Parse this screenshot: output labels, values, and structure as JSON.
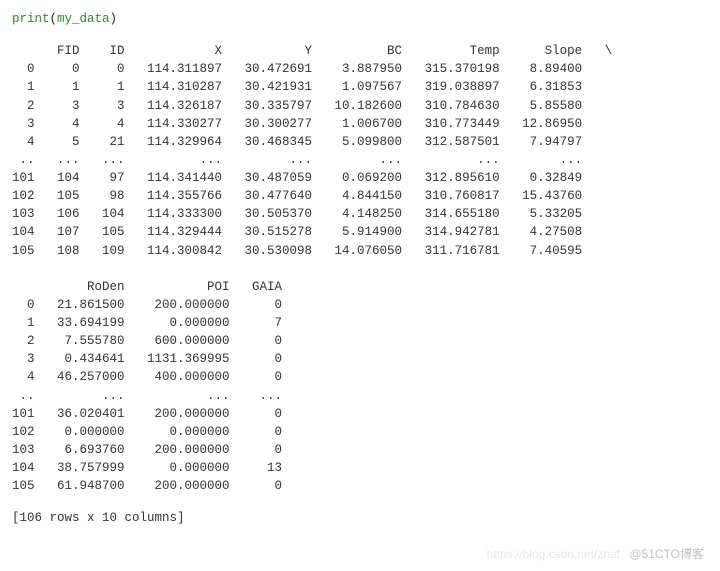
{
  "code": {
    "fn": "print",
    "open": "(",
    "arg": "my_data",
    "close": ")"
  },
  "table1": {
    "columns": [
      "",
      "FID",
      "ID",
      "X",
      "Y",
      "BC",
      "Temp",
      "Slope",
      "\\"
    ],
    "rows_top": [
      [
        "0",
        "0",
        "0",
        "114.311897",
        "30.472691",
        "3.887950",
        "315.370198",
        "8.89400",
        ""
      ],
      [
        "1",
        "1",
        "1",
        "114.310287",
        "30.421931",
        "1.097567",
        "319.038897",
        "6.31853",
        ""
      ],
      [
        "2",
        "3",
        "3",
        "114.326187",
        "30.335797",
        "10.182600",
        "310.784630",
        "5.85580",
        ""
      ],
      [
        "3",
        "4",
        "4",
        "114.330277",
        "30.300277",
        "1.006700",
        "310.773449",
        "12.86950",
        ""
      ],
      [
        "4",
        "5",
        "21",
        "114.329964",
        "30.468345",
        "5.099800",
        "312.587501",
        "7.94797",
        ""
      ]
    ],
    "ellipsis": [
      "..",
      "...",
      "...",
      "...",
      "...",
      "...",
      "...",
      "...",
      ""
    ],
    "rows_bottom": [
      [
        "101",
        "104",
        "97",
        "114.341440",
        "30.487059",
        "0.069200",
        "312.895610",
        "0.32849",
        ""
      ],
      [
        "102",
        "105",
        "98",
        "114.355766",
        "30.477640",
        "4.844150",
        "310.760817",
        "15.43760",
        ""
      ],
      [
        "103",
        "106",
        "104",
        "114.333300",
        "30.505370",
        "4.148250",
        "314.655180",
        "5.33205",
        ""
      ],
      [
        "104",
        "107",
        "105",
        "114.329444",
        "30.515278",
        "5.914900",
        "314.942781",
        "4.27508",
        ""
      ],
      [
        "105",
        "108",
        "109",
        "114.300842",
        "30.530098",
        "14.076050",
        "311.716781",
        "7.40595",
        ""
      ]
    ]
  },
  "table2": {
    "columns": [
      "",
      "RoDen",
      "POI",
      "GAIA"
    ],
    "rows_top": [
      [
        "0",
        "21.861500",
        "200.000000",
        "0"
      ],
      [
        "1",
        "33.694199",
        "0.000000",
        "7"
      ],
      [
        "2",
        "7.555780",
        "600.000000",
        "0"
      ],
      [
        "3",
        "0.434641",
        "1131.369995",
        "0"
      ],
      [
        "4",
        "46.257000",
        "400.000000",
        "0"
      ]
    ],
    "ellipsis": [
      "..",
      "...",
      "...",
      "..."
    ],
    "rows_bottom": [
      [
        "101",
        "36.020401",
        "200.000000",
        "0"
      ],
      [
        "102",
        "0.000000",
        "0.000000",
        "0"
      ],
      [
        "103",
        "6.693760",
        "200.000000",
        "0"
      ],
      [
        "104",
        "38.757999",
        "0.000000",
        "13"
      ],
      [
        "105",
        "61.948700",
        "200.000000",
        "0"
      ]
    ]
  },
  "summary": "[106 rows x 10 columns]",
  "watermark_faint": "https://blog.csdn.net/zhat",
  "watermark": "@51CTO博客",
  "chart_data": {
    "type": "table",
    "title": "pandas DataFrame printout (my_data)",
    "columns": [
      "FID",
      "ID",
      "X",
      "Y",
      "BC",
      "Temp",
      "Slope",
      "RoDen",
      "POI",
      "GAIA"
    ],
    "index_shown": [
      0,
      1,
      2,
      3,
      4,
      101,
      102,
      103,
      104,
      105
    ],
    "total_rows": 106,
    "total_columns": 10,
    "rows": [
      {
        "index": 0,
        "FID": 0,
        "ID": 0,
        "X": 114.311897,
        "Y": 30.472691,
        "BC": 3.88795,
        "Temp": 315.370198,
        "Slope": 8.894,
        "RoDen": 21.8615,
        "POI": 200.0,
        "GAIA": 0
      },
      {
        "index": 1,
        "FID": 1,
        "ID": 1,
        "X": 114.310287,
        "Y": 30.421931,
        "BC": 1.097567,
        "Temp": 319.038897,
        "Slope": 6.31853,
        "RoDen": 33.694199,
        "POI": 0.0,
        "GAIA": 7
      },
      {
        "index": 2,
        "FID": 3,
        "ID": 3,
        "X": 114.326187,
        "Y": 30.335797,
        "BC": 10.1826,
        "Temp": 310.78463,
        "Slope": 5.8558,
        "RoDen": 7.55578,
        "POI": 600.0,
        "GAIA": 0
      },
      {
        "index": 3,
        "FID": 4,
        "ID": 4,
        "X": 114.330277,
        "Y": 30.300277,
        "BC": 1.0067,
        "Temp": 310.773449,
        "Slope": 12.8695,
        "RoDen": 0.434641,
        "POI": 1131.369995,
        "GAIA": 0
      },
      {
        "index": 4,
        "FID": 5,
        "ID": 21,
        "X": 114.329964,
        "Y": 30.468345,
        "BC": 5.0998,
        "Temp": 312.587501,
        "Slope": 7.94797,
        "RoDen": 46.257,
        "POI": 400.0,
        "GAIA": 0
      },
      {
        "index": 101,
        "FID": 104,
        "ID": 97,
        "X": 114.34144,
        "Y": 30.487059,
        "BC": 0.0692,
        "Temp": 312.89561,
        "Slope": 0.32849,
        "RoDen": 36.020401,
        "POI": 200.0,
        "GAIA": 0
      },
      {
        "index": 102,
        "FID": 105,
        "ID": 98,
        "X": 114.355766,
        "Y": 30.47764,
        "BC": 4.84415,
        "Temp": 310.760817,
        "Slope": 15.4376,
        "RoDen": 0.0,
        "POI": 0.0,
        "GAIA": 0
      },
      {
        "index": 103,
        "FID": 106,
        "ID": 104,
        "X": 114.3333,
        "Y": 30.50537,
        "BC": 4.14825,
        "Temp": 314.65518,
        "Slope": 5.33205,
        "RoDen": 6.69376,
        "POI": 200.0,
        "GAIA": 0
      },
      {
        "index": 104,
        "FID": 107,
        "ID": 105,
        "X": 114.329444,
        "Y": 30.515278,
        "BC": 5.9149,
        "Temp": 314.942781,
        "Slope": 4.27508,
        "RoDen": 38.757999,
        "POI": 0.0,
        "GAIA": 13
      },
      {
        "index": 105,
        "FID": 108,
        "ID": 109,
        "X": 114.300842,
        "Y": 30.530098,
        "BC": 14.07605,
        "Temp": 311.716781,
        "Slope": 7.40595,
        "RoDen": 61.9487,
        "POI": 200.0,
        "GAIA": 0
      }
    ]
  }
}
